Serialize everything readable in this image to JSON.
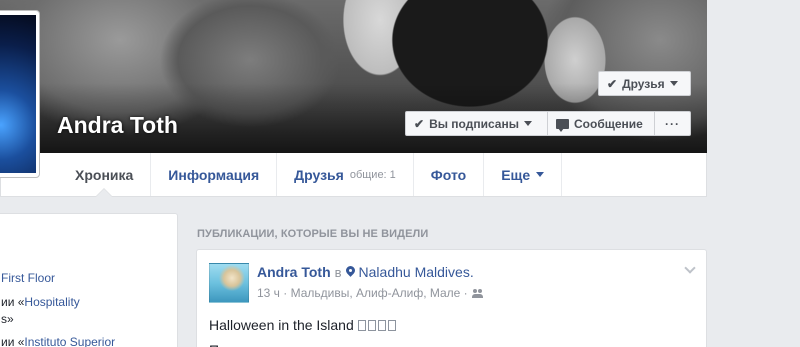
{
  "profile": {
    "name": "Andra Toth"
  },
  "cover_buttons": {
    "friends_label": "Друзья",
    "following_label": "Вы подписаны",
    "message_label": "Сообщение",
    "more_label": "···"
  },
  "nav": {
    "items": [
      {
        "label": "Хроника",
        "active": true
      },
      {
        "label": "Информация"
      },
      {
        "label": "Друзья",
        "sub": "общие: 1"
      },
      {
        "label": "Фото"
      },
      {
        "label": "Еще"
      }
    ]
  },
  "left_column": {
    "lines": [
      {
        "prefix": "",
        "link": "First Floor",
        "suffix": ""
      },
      {
        "prefix": "ии «",
        "link": "Hospitality",
        "suffix": ""
      },
      {
        "prefix": "s»",
        "link": "",
        "suffix": ""
      },
      {
        "prefix": "ии «",
        "link": "Instituto Superior",
        "suffix": ""
      }
    ]
  },
  "feed": {
    "section_header": "ПУБЛИКАЦИИ, КОТОРЫЕ ВЫ НЕ ВИДЕЛИ",
    "post": {
      "author": "Andra Toth",
      "in_word": "в",
      "place": "Naladhu Maldives.",
      "meta": "13 ч · Мальдивы, Алиф-Алиф, Мале ·",
      "text": "Halloween in the Island",
      "text_glyph_count": 4,
      "text_line2": "П"
    }
  },
  "colors": {
    "page_bg": "#e9ebee",
    "link": "#365899",
    "muted": "#90949c",
    "button_bg": "#f6f7f9"
  },
  "icons": [
    "check-icon",
    "caret-down-icon",
    "message-icon",
    "more-dots-icon",
    "location-pin-icon",
    "friends-audience-icon",
    "post-options-chevron-icon"
  ]
}
